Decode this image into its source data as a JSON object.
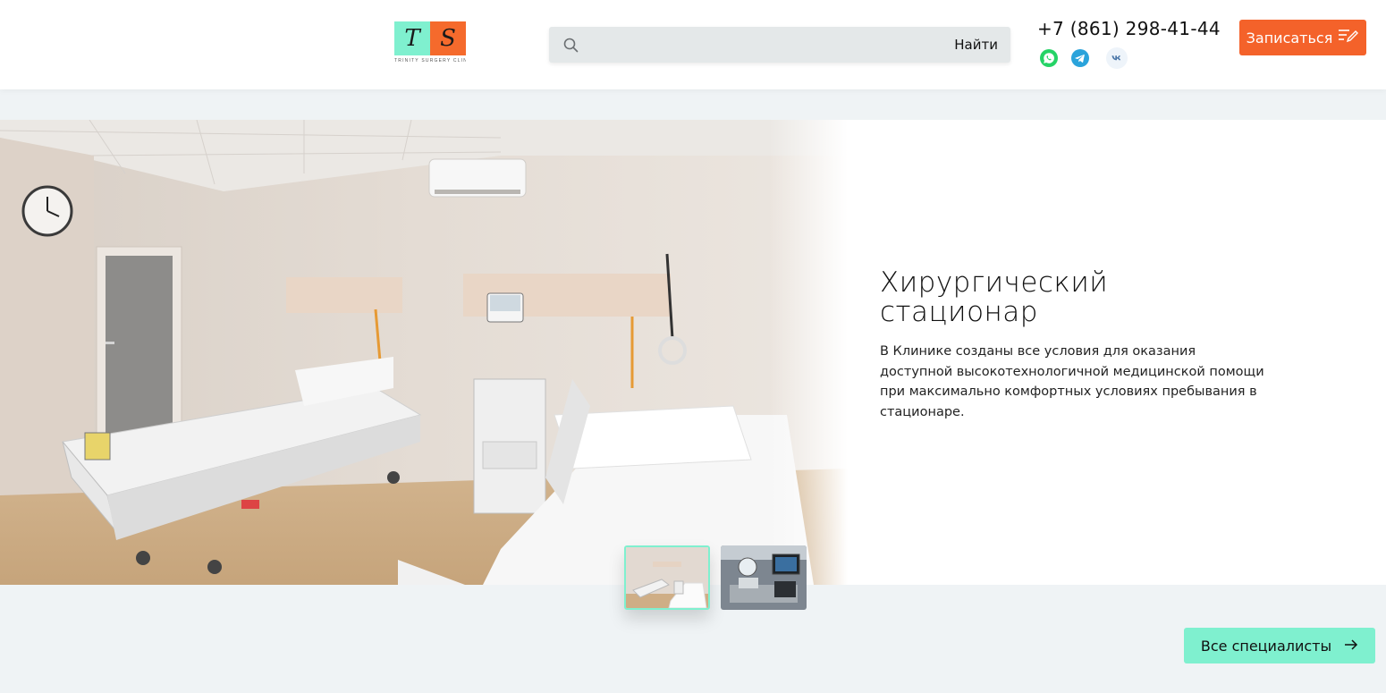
{
  "header": {
    "logo": {
      "letter_left": "T",
      "letter_right": "S",
      "tagline": "TRINITY SURGERY CLINIC",
      "colors": {
        "mint": "#7ff0cf",
        "orange": "#f56a2c"
      }
    },
    "search": {
      "icon": "search-icon",
      "placeholder": "",
      "value": "",
      "button_label": "Найти"
    },
    "phone": "+7 (861) 298-41-44",
    "social": [
      {
        "name": "whatsapp",
        "icon": "whatsapp-icon",
        "color": "#25d366"
      },
      {
        "name": "telegram",
        "icon": "telegram-icon",
        "color": "#2aa3db"
      },
      {
        "name": "vk",
        "icon": "vk-icon",
        "color": "#4a76a8"
      }
    ],
    "signup_button": {
      "label": "Записаться",
      "icon": "edit-list-icon",
      "color": "#f4622a"
    }
  },
  "hero": {
    "title": "Хирургический стационар",
    "text": "В Клинике созданы все условия для оказания доступной высокотехнологичной медицинской помощи при максимально комфортных условиях пребывания в стационаре.",
    "photo": "hospital-ward-photo",
    "thumbnails": [
      {
        "name": "hospital-ward-thumbnail",
        "active": true
      },
      {
        "name": "operating-room-thumbnail",
        "active": false
      }
    ]
  },
  "footer_actions": {
    "all_specialists": {
      "label": "Все специалисты",
      "icon": "arrow-right-icon",
      "color": "#7ff0cf"
    }
  }
}
